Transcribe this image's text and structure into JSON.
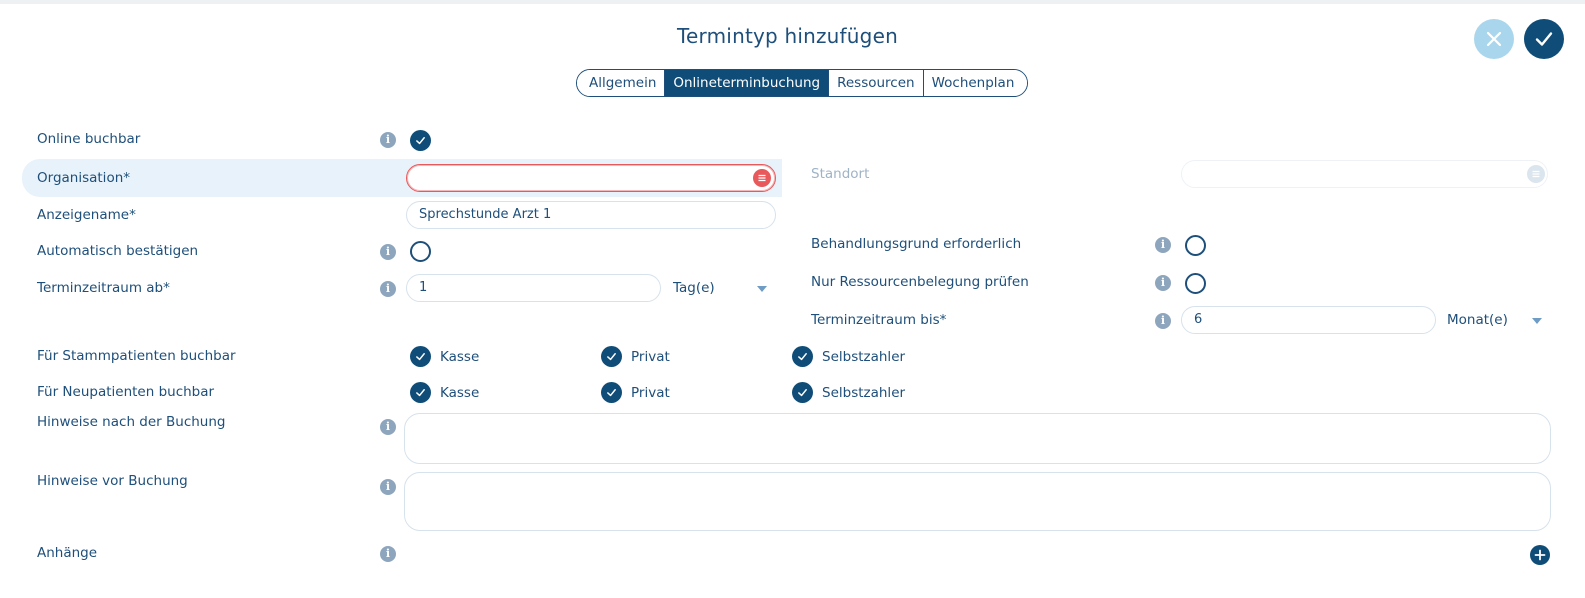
{
  "dialog": {
    "title": "Termintyp hinzufügen"
  },
  "tabs": [
    {
      "label": "Allgemein",
      "active": false
    },
    {
      "label": "Onlineterminbuchung",
      "active": true
    },
    {
      "label": "Ressourcen",
      "active": false
    },
    {
      "label": "Wochenplan",
      "active": false
    }
  ],
  "colors": {
    "primary": "#0f4d78",
    "accent_light": "#a9d6ec",
    "error": "#e8595c",
    "row_highlight": "#e8f2fa"
  },
  "form": {
    "online_buchbar": {
      "label": "Online buchbar",
      "checked": true
    },
    "organisation": {
      "label": "Organisation*",
      "value": ""
    },
    "standort": {
      "label": "Standort",
      "value": ""
    },
    "anzeigename": {
      "label": "Anzeigename*",
      "value": "Sprechstunde Arzt 1"
    },
    "automatisch_bestaetigen": {
      "label": "Automatisch bestätigen",
      "checked": false
    },
    "behandlungsgrund": {
      "label": "Behandlungsgrund erforderlich",
      "checked": false
    },
    "nur_ressourcen": {
      "label": "Nur Ressourcenbelegung prüfen",
      "checked": false
    },
    "terminzeitraum_ab": {
      "label": "Terminzeitraum ab*",
      "value": "1",
      "unit": "Tag(e)"
    },
    "terminzeitraum_bis": {
      "label": "Terminzeitraum bis*",
      "value": "6",
      "unit": "Monat(e)"
    },
    "stammpatienten": {
      "label": "Für Stammpatienten buchbar",
      "options": [
        {
          "label": "Kasse",
          "checked": true
        },
        {
          "label": "Privat",
          "checked": true
        },
        {
          "label": "Selbstzahler",
          "checked": true
        }
      ]
    },
    "neupatienten": {
      "label": "Für Neupatienten buchbar",
      "options": [
        {
          "label": "Kasse",
          "checked": true
        },
        {
          "label": "Privat",
          "checked": true
        },
        {
          "label": "Selbstzahler",
          "checked": true
        }
      ]
    },
    "hinweise_nach": {
      "label": "Hinweise nach der Buchung",
      "value": ""
    },
    "hinweise_vor": {
      "label": "Hinweise vor Buchung",
      "value": ""
    },
    "anhaenge": {
      "label": "Anhänge"
    }
  }
}
